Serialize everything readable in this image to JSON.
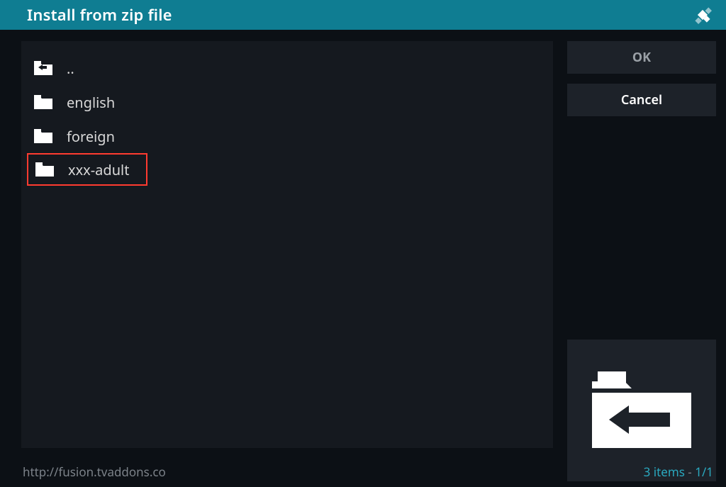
{
  "header": {
    "title": "Install from zip file"
  },
  "list": {
    "items": [
      {
        "label": "..",
        "icon": "folder-back-icon",
        "highlighted": false
      },
      {
        "label": "english",
        "icon": "folder-icon",
        "highlighted": false
      },
      {
        "label": "foreign",
        "icon": "folder-icon",
        "highlighted": false
      },
      {
        "label": "xxx-adult",
        "icon": "folder-icon",
        "highlighted": true
      }
    ]
  },
  "buttons": {
    "ok_label": "OK",
    "cancel_label": "Cancel"
  },
  "status": {
    "path": "http://fusion.tvaddons.co",
    "count_label": "3 items",
    "page_label": "1/1"
  },
  "colors": {
    "header_bg": "#0f7d92",
    "panel_bg": "#15191f",
    "button_bg": "#1d2229",
    "highlight_border": "#ff3b30",
    "accent": "#2aa8bf"
  }
}
